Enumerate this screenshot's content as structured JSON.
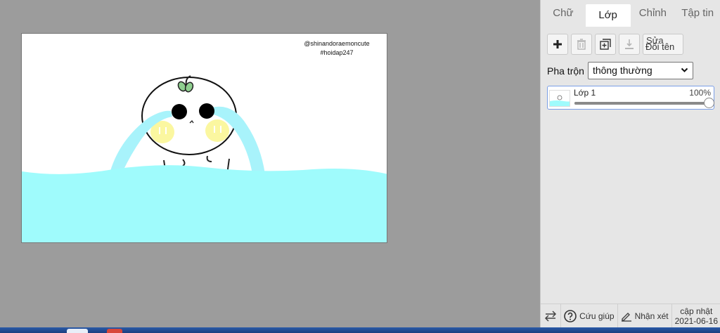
{
  "canvas": {
    "watermark_line1": "@shinandoraemoncute",
    "watermark_line2": "#hoidap247",
    "colors": {
      "water": "#9ffbfc",
      "tears": "#a8f3fb",
      "cheeks": "#fbf7a0",
      "sprout": "#8fcf8f"
    }
  },
  "panel": {
    "tabs": [
      {
        "label": "Chữ",
        "active": false
      },
      {
        "label": "Lớp",
        "active": true
      },
      {
        "label": "Chỉnh",
        "active": false
      },
      {
        "label": "Tập tin",
        "active": false
      }
    ],
    "toolbar": {
      "add_icon": "plus-icon",
      "delete_icon": "trash-icon",
      "duplicate_icon": "duplicate-icon",
      "merge_icon": "merge-down-icon",
      "rename_line1": "Sửa",
      "rename_line2": "Đổi tên"
    },
    "blend": {
      "label": "Pha trộn",
      "selected": "thông thường"
    },
    "layers": [
      {
        "name": "Lớp 1",
        "opacity_label": "100%",
        "opacity": 1.0
      }
    ],
    "footer": {
      "swap_icon": "swap-arrows-icon",
      "help_label": "Cứu giúp",
      "feedback_label": "Nhận xét",
      "update_label": "cập nhật",
      "update_date": "2021-06-16"
    },
    "accent": "#7a9ee6"
  }
}
